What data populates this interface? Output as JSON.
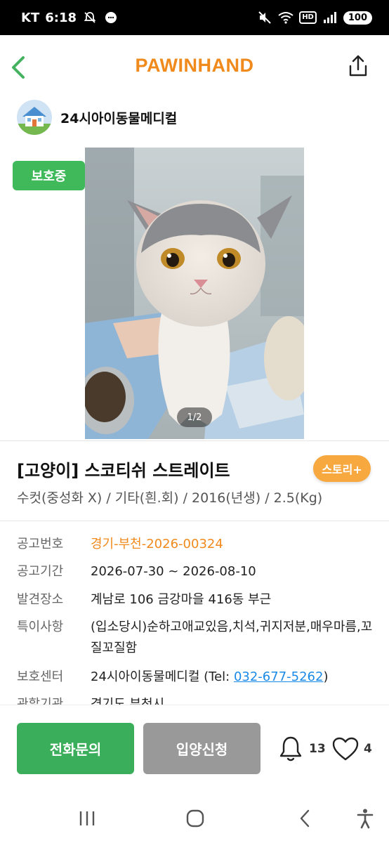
{
  "status_bar": {
    "carrier": "KT",
    "time": "6:18",
    "battery": "100",
    "hd_label": "HD"
  },
  "header": {
    "brand": "PAWINHAND"
  },
  "shelter": {
    "name": "24시아이동물메디컬"
  },
  "photo": {
    "status_badge": "보호중",
    "page_indicator": "1/2"
  },
  "animal": {
    "title": "[고양이] 스코티쉬 스트레이트",
    "story_button": "스토리+",
    "summary": "수컷(중성화 X) / 기타(흰.회) / 2016(년생) / 2.5(Kg)"
  },
  "info": {
    "notice_no_label": "공고번호",
    "notice_no": "경기-부천-2026-00324",
    "period_label": "공고기간",
    "period": "2026-07-30 ~ 2026-08-10",
    "found_label": "발견장소",
    "found_place": "계남로 106 금강마을 416동 부근",
    "features_label": "특이사항",
    "features": "(입소당시)순하고애교있음,치석,귀지저분,매우마름,꼬질꼬질함",
    "center_label": "보호센터",
    "center_name": "24시아이동물메디컬 (Tel: ",
    "center_phone": "032-677-5262",
    "center_close": ")",
    "agency_label": "관할기관",
    "agency": "경기도 부천시"
  },
  "actions": {
    "call_label": "전화문의",
    "adopt_label": "입양신청",
    "bell_count": "13",
    "like_count": "4"
  },
  "colors": {
    "brand_orange": "#f08a1c",
    "status_green": "#3fb95a",
    "call_green": "#3aae5a",
    "adopt_gray": "#999999",
    "story_orange": "#f7a83f",
    "link_blue": "#1a8ae6"
  }
}
